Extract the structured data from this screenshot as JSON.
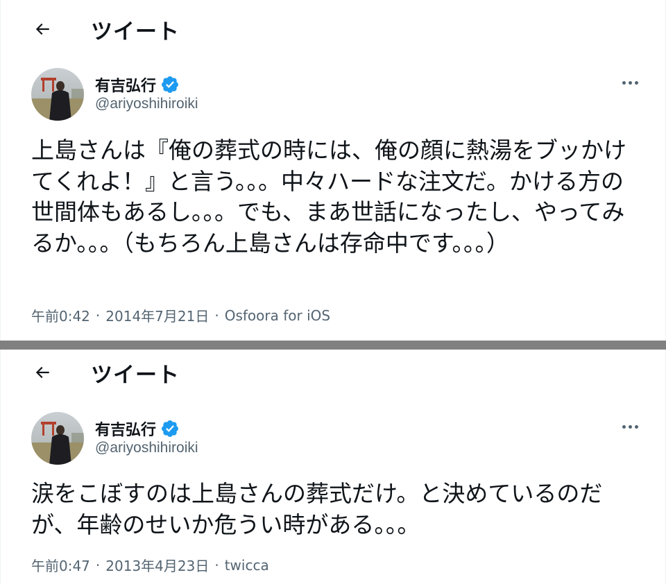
{
  "tweets": [
    {
      "header_title": "ツイート",
      "display_name": "有吉弘行",
      "handle": "@ariyoshihiroiki",
      "text": "上島さんは『俺の葬式の時には、俺の顔に熱湯をブッかけてくれよ！』と言う。。。中々ハードな注文だ。かける方の世間体もあるし。。。でも、まあ世話になったし、やってみるか。。。（もちろん上島さんは存命中です。。。）",
      "time": "午前0:42",
      "date": "2014年7月21日",
      "source": "Osfoora for iOS",
      "separator": "·"
    },
    {
      "header_title": "ツイート",
      "display_name": "有吉弘行",
      "handle": "@ariyoshihiroiki",
      "text": "涙をこぼすのは上島さんの葬式だけ。と決めているのだが、年齢のせいか危うい時がある。。。",
      "time": "午前0:47",
      "date": "2013年4月23日",
      "source": "twicca",
      "separator": "·"
    }
  ],
  "icons": {
    "back": "arrow-left-icon",
    "verified": "verified-badge-icon",
    "more": "more-dots-icon"
  },
  "colors": {
    "verified": "#1d9bf0",
    "text": "#0f1419",
    "secondary": "#536471",
    "divider": "#808080"
  }
}
